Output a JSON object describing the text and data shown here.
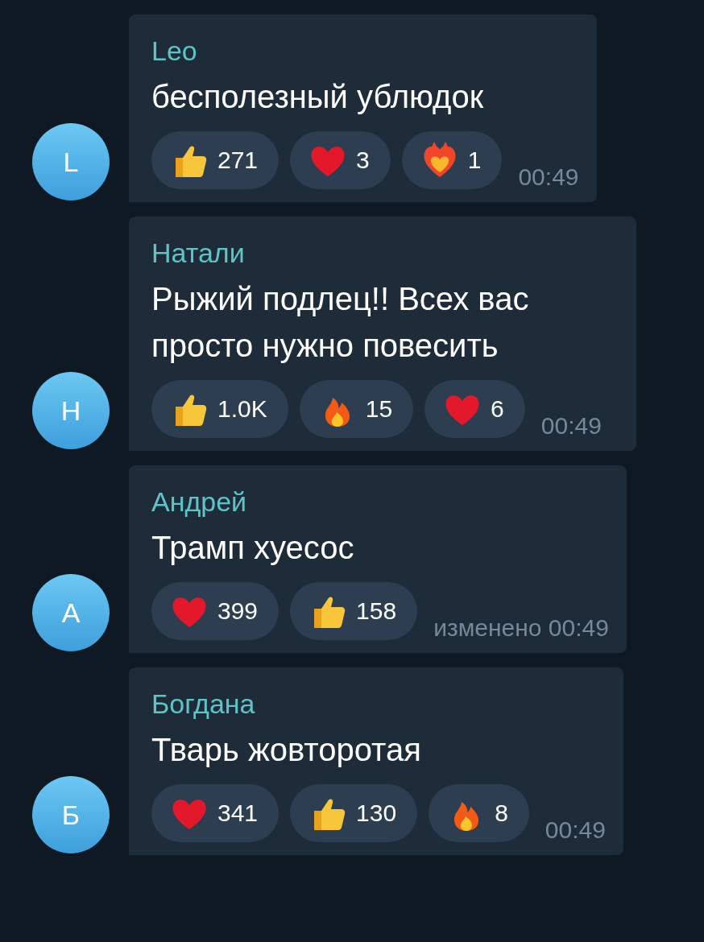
{
  "messages": [
    {
      "avatar": "L",
      "author": "Leo",
      "text": "бесполезный ублюдок",
      "reactions": [
        {
          "kind": "thumbs",
          "count": "271"
        },
        {
          "kind": "heart",
          "count": "3"
        },
        {
          "kind": "heart_fire",
          "count": "1"
        }
      ],
      "time": "00:49"
    },
    {
      "avatar": "Н",
      "author": "Натали",
      "text": "Рыжий подлец!! Всех вас просто нужно повесить",
      "reactions": [
        {
          "kind": "thumbs",
          "count": "1.0K"
        },
        {
          "kind": "fire",
          "count": "15"
        },
        {
          "kind": "heart",
          "count": "6"
        }
      ],
      "time": "00:49"
    },
    {
      "avatar": "А",
      "author": "Андрей",
      "text": "Трамп хуесос",
      "reactions": [
        {
          "kind": "heart",
          "count": "399"
        },
        {
          "kind": "thumbs",
          "count": "158"
        }
      ],
      "time": "изменено 00:49"
    },
    {
      "avatar": "Б",
      "author": "Богдана",
      "text": "Тварь жовторотая",
      "reactions": [
        {
          "kind": "heart",
          "count": "341"
        },
        {
          "kind": "thumbs",
          "count": "130"
        },
        {
          "kind": "fire",
          "count": "8"
        }
      ],
      "time": "00:49"
    }
  ]
}
